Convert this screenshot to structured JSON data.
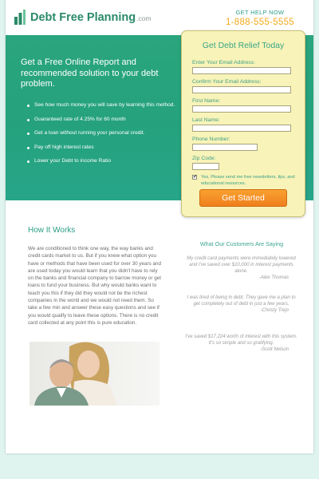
{
  "header": {
    "brand_name": "Debt Free Planning",
    "brand_suffix": ".com",
    "help_label": "GET HELP NOW",
    "phone": "1-888-555-5555",
    "logo_icon": "chart-bars-icon"
  },
  "hero": {
    "headline": "Get a Free Online Report and recommended solution to your debt problem.",
    "bullets": [
      "See how much money you will save by learning this method.",
      "Guaranteed rate of 4.25% for 60 month",
      "Get a loan without running your personal credit.",
      "Pay off high interest rates",
      "Lower your Debt to income Ratio"
    ]
  },
  "form": {
    "title": "Get Debt Relief Today",
    "fields": [
      {
        "label": "Enter Your Email Address:",
        "value": ""
      },
      {
        "label": "Confirm Your Email Address:",
        "value": ""
      },
      {
        "label": "First Name:",
        "value": ""
      },
      {
        "label": "Last Name:",
        "value": ""
      },
      {
        "label": "Phone Number:",
        "value": ""
      },
      {
        "label": "Zip Code:",
        "value": ""
      }
    ],
    "consent_checked": true,
    "consent_text": "Yes, Please send me free newsletters, tips, and educational resources.",
    "submit_label": "Get Started"
  },
  "content": {
    "section_title": "How It Works",
    "body": "We are conditioned to think one way, the way banks and credit cards market to us. But if you knew what option you have or methods that have been used for over 30 years and are used today you would learn that you didn't have to rely on the banks and financial company to barrow money or get loans to fund your business. But why would banks want to teach you this if they did they would not be the richest companies in the world and we would not need them. So take a few min and answer these easy questions and see if you would qualify to leave these options. There is no credit card collected at any point this is pure education."
  },
  "testimonials": {
    "title": "What Our Customers Are Saying",
    "items": [
      {
        "quote": "My credit card payments were immediately lowered and I've saved over $10,000 in interest payments alone.",
        "author": "-Alex Thomas"
      },
      {
        "quote": "I was tired of being in debt. They gave me a plan to get completely out of debt in just a few years.",
        "author": "-Christy Trejo"
      },
      {
        "quote": "I've saved $17,224 worth of interest with this system. It's so simple and so gratifying.",
        "author": "-Scott Nelson"
      }
    ]
  },
  "colors": {
    "brand_green": "#2a8a68",
    "hero_green": "#26a27d",
    "accent_orange": "#f2a91a",
    "form_yellow": "#f8f3b8",
    "button_orange": "#f28a22"
  }
}
